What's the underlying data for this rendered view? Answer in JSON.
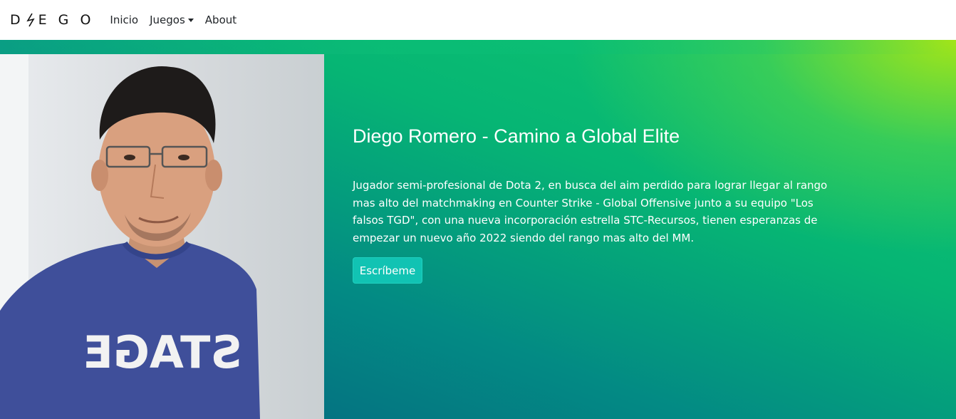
{
  "navbar": {
    "brand": "D ϟ E G O",
    "links": [
      "Inicio",
      "Juegos",
      "About"
    ]
  },
  "hero": {
    "title": "Diego Romero - Camino a Global Elite",
    "text": "Jugador semi-profesional de Dota 2, en busca del aim perdido para lograr llegar al rango mas alto del matchmaking en Counter Strike - Global Offensive junto a su equipo \"Los falsos TGD\", con una nueva incorporación estrella STC-Recursos, tienen esperanzas de empezar un nuevo año 2022 siendo del rango mas alto del MM.",
    "button_label": "Escríbeme"
  },
  "portrait": {
    "shirt_print": "STAGE"
  },
  "colors": {
    "button": "#11c3b3",
    "gradient_top_right": "#a8e515",
    "gradient_bottom": "#05607f"
  }
}
